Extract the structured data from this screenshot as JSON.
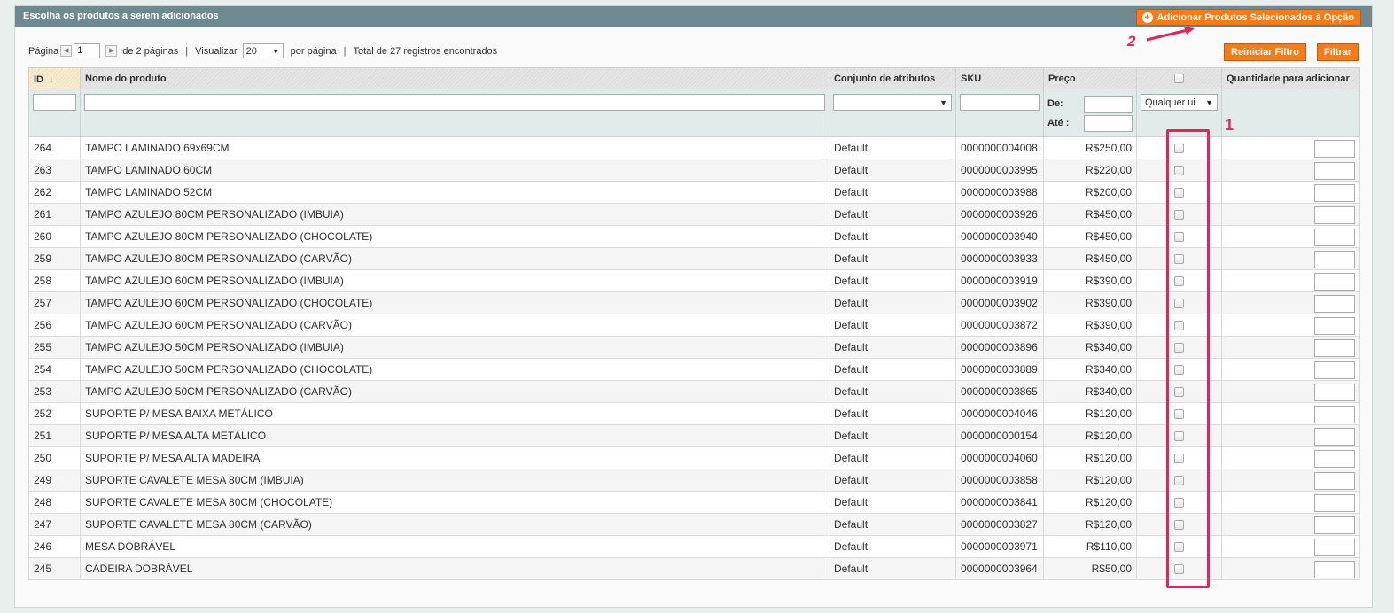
{
  "header": {
    "title": "Escolha os produtos a serem adicionados",
    "add_button": "Adicionar Produtos Selecionados à Opção"
  },
  "pager": {
    "page_label": "Página",
    "page_value": "1",
    "pages_text": "de 2 páginas",
    "view_label": "Visualizar",
    "per_page_value": "20",
    "per_page_text": "por página",
    "total_text": "Total de 27 registros encontrados"
  },
  "actions": {
    "reset_filter": "Reiniciar Filtro",
    "filter": "Filtrar"
  },
  "annotations": {
    "one": "1",
    "two": "2",
    "accent_color": "#e0245e"
  },
  "columns": {
    "id": "ID",
    "name": "Nome do produto",
    "attr_set": "Conjunto de atributos",
    "sku": "SKU",
    "price": "Preço",
    "qty": "Quantidade para adicionar"
  },
  "filters": {
    "price_from": "De:",
    "price_to": "Até :",
    "select_any": "Qualquer ui"
  },
  "rows": [
    {
      "id": "264",
      "name": "TAMPO LAMINADO 69x69CM",
      "set": "Default",
      "sku": "0000000004008",
      "price": "R$250,00"
    },
    {
      "id": "263",
      "name": "TAMPO LAMINADO 60CM",
      "set": "Default",
      "sku": "0000000003995",
      "price": "R$220,00"
    },
    {
      "id": "262",
      "name": "TAMPO LAMINADO 52CM",
      "set": "Default",
      "sku": "0000000003988",
      "price": "R$200,00"
    },
    {
      "id": "261",
      "name": "TAMPO AZULEJO 80CM PERSONALIZADO (IMBUIA)",
      "set": "Default",
      "sku": "0000000003926",
      "price": "R$450,00"
    },
    {
      "id": "260",
      "name": "TAMPO AZULEJO 80CM PERSONALIZADO (CHOCOLATE)",
      "set": "Default",
      "sku": "0000000003940",
      "price": "R$450,00"
    },
    {
      "id": "259",
      "name": "TAMPO AZULEJO 80CM PERSONALIZADO (CARVÃO)",
      "set": "Default",
      "sku": "0000000003933",
      "price": "R$450,00"
    },
    {
      "id": "258",
      "name": "TAMPO AZULEJO 60CM PERSONALIZADO (IMBUIA)",
      "set": "Default",
      "sku": "0000000003919",
      "price": "R$390,00"
    },
    {
      "id": "257",
      "name": "TAMPO AZULEJO 60CM PERSONALIZADO (CHOCOLATE)",
      "set": "Default",
      "sku": "0000000003902",
      "price": "R$390,00"
    },
    {
      "id": "256",
      "name": "TAMPO AZULEJO 60CM PERSONALIZADO (CARVÃO)",
      "set": "Default",
      "sku": "0000000003872",
      "price": "R$390,00"
    },
    {
      "id": "255",
      "name": "TAMPO AZULEJO 50CM PERSONALIZADO (IMBUIA)",
      "set": "Default",
      "sku": "0000000003896",
      "price": "R$340,00"
    },
    {
      "id": "254",
      "name": "TAMPO AZULEJO 50CM PERSONALIZADO (CHOCOLATE)",
      "set": "Default",
      "sku": "0000000003889",
      "price": "R$340,00"
    },
    {
      "id": "253",
      "name": "TAMPO AZULEJO 50CM PERSONALIZADO (CARVÃO)",
      "set": "Default",
      "sku": "0000000003865",
      "price": "R$340,00"
    },
    {
      "id": "252",
      "name": "SUPORTE P/ MESA BAIXA METÁLICO",
      "set": "Default",
      "sku": "0000000004046",
      "price": "R$120,00"
    },
    {
      "id": "251",
      "name": "SUPORTE P/ MESA ALTA METÁLICO",
      "set": "Default",
      "sku": "0000000000154",
      "price": "R$120,00"
    },
    {
      "id": "250",
      "name": "SUPORTE P/ MESA ALTA MADEIRA",
      "set": "Default",
      "sku": "0000000004060",
      "price": "R$120,00"
    },
    {
      "id": "249",
      "name": "SUPORTE CAVALETE MESA 80CM (IMBUIA)",
      "set": "Default",
      "sku": "0000000003858",
      "price": "R$120,00"
    },
    {
      "id": "248",
      "name": "SUPORTE CAVALETE MESA 80CM (CHOCOLATE)",
      "set": "Default",
      "sku": "0000000003841",
      "price": "R$120,00"
    },
    {
      "id": "247",
      "name": "SUPORTE CAVALETE MESA 80CM (CARVÃO)",
      "set": "Default",
      "sku": "0000000003827",
      "price": "R$120,00"
    },
    {
      "id": "246",
      "name": "MESA DOBRÁVEL",
      "set": "Default",
      "sku": "0000000003971",
      "price": "R$110,00"
    },
    {
      "id": "245",
      "name": "CADEIRA DOBRÁVEL",
      "set": "Default",
      "sku": "0000000003964",
      "price": "R$50,00"
    }
  ]
}
